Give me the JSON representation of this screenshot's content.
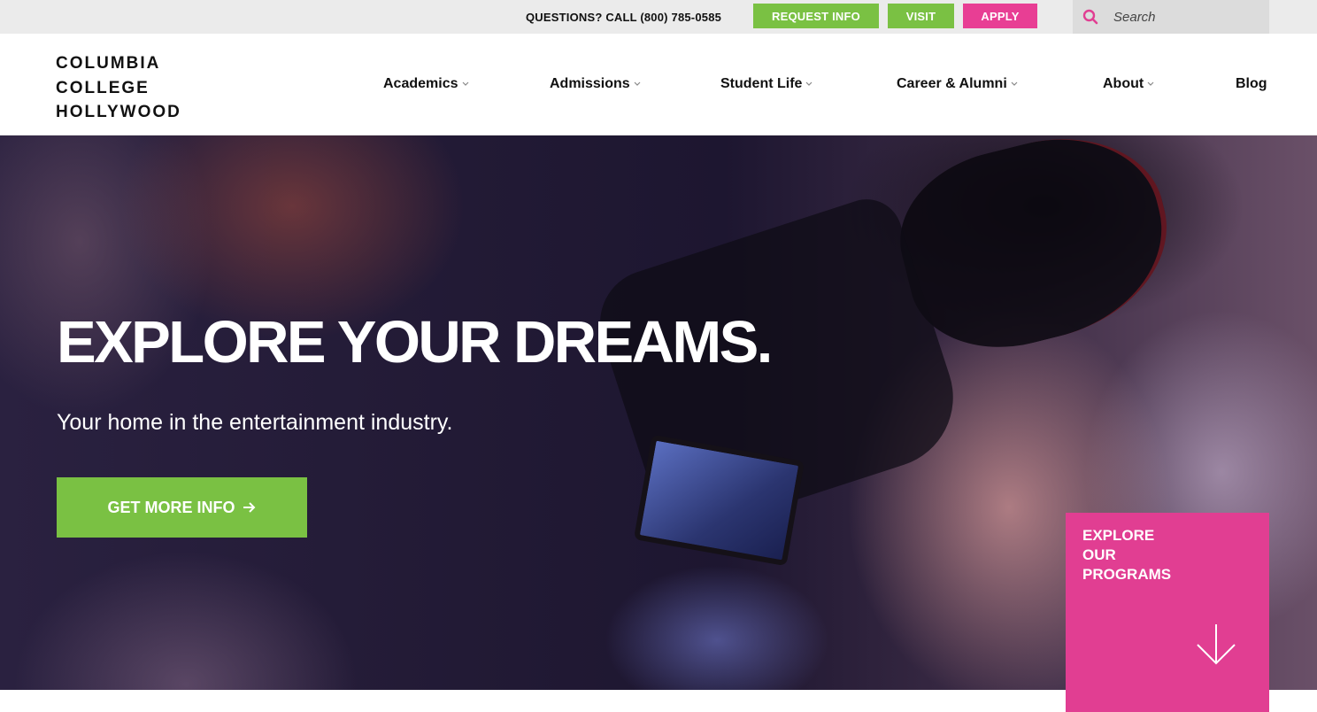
{
  "utility": {
    "phone_text": "QUESTIONS? CALL (800) 785-0585",
    "request_info_label": "REQUEST INFO",
    "visit_label": "VISIT",
    "apply_label": "APPLY",
    "search_placeholder": "Search",
    "search_icon": "search-icon"
  },
  "brand": {
    "logo_lines": [
      "COLUMBIA",
      "COLLEGE",
      "HOLLYWOOD"
    ]
  },
  "nav": {
    "items": [
      {
        "label": "Academics",
        "has_dropdown": true
      },
      {
        "label": "Admissions",
        "has_dropdown": true
      },
      {
        "label": "Student Life",
        "has_dropdown": true
      },
      {
        "label": "Career & Alumni",
        "has_dropdown": true
      },
      {
        "label": "About",
        "has_dropdown": true
      },
      {
        "label": "Blog",
        "has_dropdown": false
      }
    ]
  },
  "hero": {
    "title": "EXPLORE YOUR DREAMS.",
    "subtitle": "Your home in the entertainment industry.",
    "cta_label": "GET MORE INFO",
    "cta_icon": "arrow-right-icon"
  },
  "programs": {
    "label_lines": [
      "EXPLORE",
      "OUR",
      "PROGRAMS"
    ],
    "icon": "arrow-down-icon"
  },
  "colors": {
    "green": "#7ac143",
    "pink": "#e83e94",
    "utility_bg": "#ebebeb"
  }
}
